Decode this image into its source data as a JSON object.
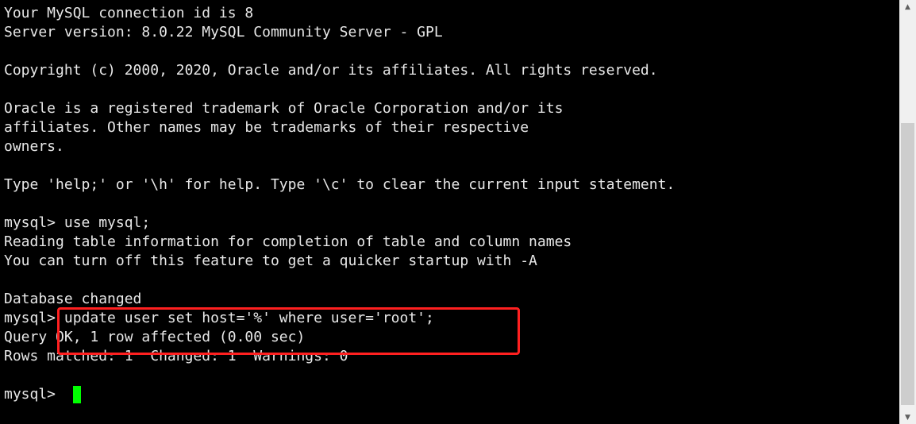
{
  "terminal": {
    "lines": [
      "Your MySQL connection id is 8",
      "Server version: 8.0.22 MySQL Community Server - GPL",
      "",
      "Copyright (c) 2000, 2020, Oracle and/or its affiliates. All rights reserved.",
      "",
      "Oracle is a registered trademark of Oracle Corporation and/or its",
      "affiliates. Other names may be trademarks of their respective",
      "owners.",
      "",
      "Type 'help;' or '\\h' for help. Type '\\c' to clear the current input statement.",
      "",
      "mysql> use mysql;",
      "Reading table information for completion of table and column names",
      "You can turn off this feature to get a quicker startup with -A",
      "",
      "Database changed",
      "mysql> update user set host='%' where user='root';",
      "Query OK, 1 row affected (0.00 sec)",
      "Rows matched: 1  Changed: 1  Warnings: 0",
      ""
    ],
    "prompt": "mysql> ",
    "cursor_color": "#00ff00",
    "highlight_color": "#ff2020"
  },
  "scrollbar": {
    "up_icon": "▲",
    "down_icon": "▼"
  }
}
